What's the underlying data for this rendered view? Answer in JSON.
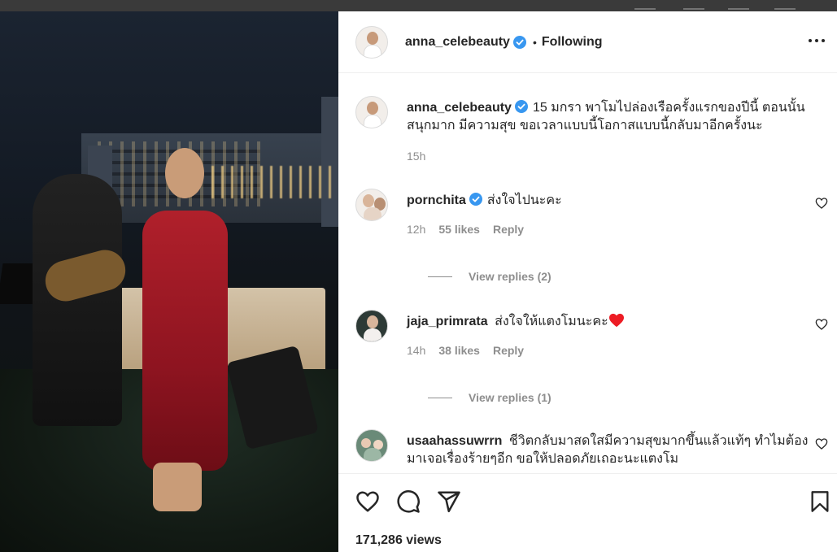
{
  "post": {
    "author": "anna_celebeauty",
    "follow_status": "Following",
    "separator": "•",
    "caption": "15 มกรา พาโมไปล่องเรือครั้งแรกของปีนี้ ตอนนั้นสนุกมาก มีความสุข ขอเวลาแบบนี้โอกาสแบบนี้กลับมาอีกครั้งนะ",
    "caption_time": "15h",
    "views": "171,286 views"
  },
  "comments": [
    {
      "username": "pornchita",
      "verified": true,
      "text": "ส่งใจไปนะคะ",
      "time": "12h",
      "likes": "55 likes",
      "reply": "Reply",
      "view_replies": "View replies (2)"
    },
    {
      "username": "jaja_primrata",
      "verified": false,
      "text": "ส่งใจให้แตงโมนะคะ",
      "time": "14h",
      "likes": "38 likes",
      "reply": "Reply",
      "view_replies": "View replies (1)"
    },
    {
      "username": "usaahassuwrrn",
      "verified": false,
      "text": "ชีวิตกลับมาสดใสมีความสุขมากขึ้นแล้วแท้ๆ ทำไมต้องมาเจอเรื่องร้ายๆอีก ขอให้ปลอดภัยเถอะนะแตงโม"
    }
  ],
  "icons": {
    "verified": "verified-badge-icon",
    "more": "more-options-icon",
    "like": "heart-icon",
    "comment": "comment-icon",
    "share": "share-icon",
    "save": "bookmark-icon",
    "emoji": "red-heart-emoji"
  },
  "colors": {
    "verified_blue": "#3897f0",
    "text": "#262626",
    "secondary_text": "#8e8e8e",
    "emoji_red": "#ed1c24"
  }
}
